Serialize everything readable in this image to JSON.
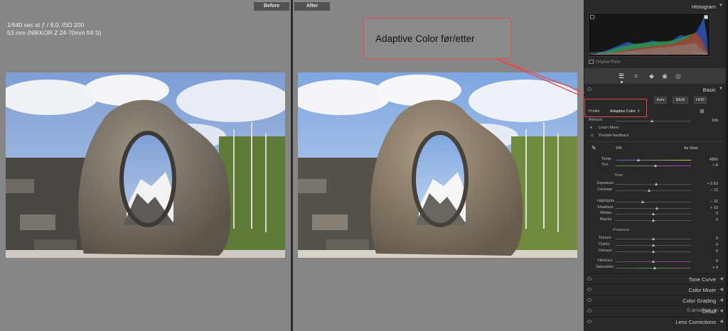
{
  "compare": {
    "before_label": "Before",
    "after_label": "After",
    "exif_line1": "1/640 sec at ƒ / 9,0, ISO 200",
    "exif_line2": "53 mm (NIKKOR Z 24-70mm f/4 S)"
  },
  "annotation": {
    "text": "Adaptive Color før/etter",
    "color": "#e74a4a"
  },
  "panel": {
    "histogram": {
      "title": "Histogram",
      "iso": "ISO 200",
      "focal": "53 mm",
      "aperture": "f / 9,0",
      "shutter": "1/640 sec",
      "original_photo": "Original Photo"
    },
    "basic": {
      "title": "Basic",
      "auto": "Auto",
      "bw": "B&W",
      "hdr": "HDR",
      "profile_label": "Profile",
      "profile_value": "Adaptive Color",
      "amount_label": "Amount",
      "amount_value": "100",
      "learn_more": "Learn More",
      "feedback": "Provide feedback",
      "wb_label": "WB",
      "wb_value": "As Shot",
      "temp_label": "Temp",
      "temp_value": "4860",
      "tint_label": "Tint",
      "tint_value": "+ 8",
      "tone_label": "Tone",
      "exposure_label": "Exposure",
      "exposure_value": "+ 0.53",
      "contrast_label": "Contrast",
      "contrast_value": "− 12",
      "highlights_label": "Highlights",
      "highlights_value": "− 31",
      "shadows_label": "Shadows",
      "shadows_value": "+ 10",
      "whites_label": "Whites",
      "whites_value": "0",
      "blacks_label": "Blacks",
      "blacks_value": "0",
      "presence_label": "Presence",
      "texture_label": "Texture",
      "texture_value": "0",
      "clarity_label": "Clarity",
      "clarity_value": "0",
      "dehaze_label": "Dehaze",
      "dehaze_value": "0",
      "vibrance_label": "Vibrance",
      "vibrance_value": "0",
      "saturation_label": "Saturation",
      "saturation_value": "+ 4"
    },
    "collapsed": [
      "Tone Curve",
      "Color Mixer",
      "Color Grading",
      "Detail",
      "Lens Corrections"
    ],
    "watermark": "© arnolfoto.no"
  }
}
